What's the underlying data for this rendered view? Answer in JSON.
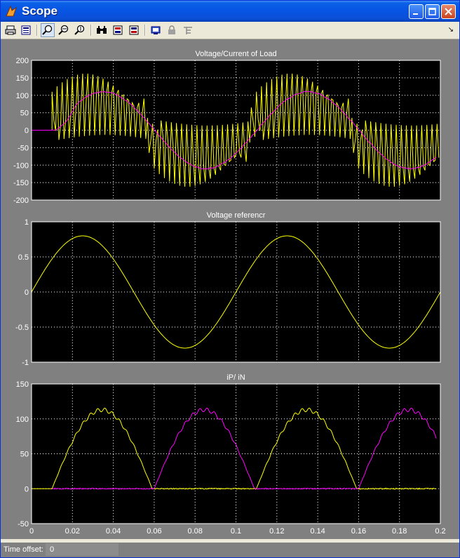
{
  "window": {
    "title": "Scope"
  },
  "toolbar": {
    "icons": [
      "print-icon",
      "parameters-icon",
      "zoom-icon",
      "zoom-x-icon",
      "zoom-y-icon",
      "autoscale-icon",
      "save-axes-icon",
      "restore-axes-icon",
      "floating-scope-icon",
      "lock-icon",
      "signal-selection-icon"
    ]
  },
  "status": {
    "label": "Time offset:",
    "value": "0"
  },
  "colors": {
    "background": "#000000",
    "axes_bg": "#808080",
    "series_yellow": "#ffff00",
    "series_magenta": "#ff00ff",
    "grid": "#ffffff"
  },
  "chart_data": [
    {
      "type": "line",
      "title": "Voltage/Current of Load",
      "xlim": [
        0,
        0.2
      ],
      "ylim": [
        -200,
        200
      ],
      "yticks": [
        -200,
        -150,
        -100,
        -50,
        0,
        50,
        100,
        150,
        200
      ],
      "xticks": [
        0,
        0.02,
        0.04,
        0.06,
        0.08,
        0.1,
        0.12,
        0.14,
        0.16,
        0.18,
        0.2
      ],
      "show_xtick_labels": false,
      "grid": true,
      "series": [
        {
          "color": "#ffff00",
          "kind": "pwm",
          "description_values": {
            "amplitude": 170,
            "freq_hz": 10,
            "start": 0.01,
            "pulses_per_period": 40
          },
          "values": []
        },
        {
          "color": "#ff00ff",
          "kind": "sine_ramp",
          "description_values": {
            "amplitude": 110,
            "freq_hz": 10,
            "start": 0.01,
            "phase_lag": 0.005
          },
          "values": []
        }
      ]
    },
    {
      "type": "line",
      "title": "Voltage referencr",
      "xlim": [
        0,
        0.2
      ],
      "ylim": [
        -1,
        1
      ],
      "yticks": [
        -1,
        -0.5,
        0,
        0.5,
        1
      ],
      "xticks": [
        0,
        0.02,
        0.04,
        0.06,
        0.08,
        0.1,
        0.12,
        0.14,
        0.16,
        0.18,
        0.2
      ],
      "show_xtick_labels": false,
      "grid": true,
      "series": [
        {
          "color": "#ffff00",
          "kind": "sine",
          "description_values": {
            "amplitude": 0.8,
            "freq_hz": 10,
            "start": 0
          },
          "values": []
        }
      ]
    },
    {
      "type": "line",
      "title": "iP/ iN",
      "xlim": [
        0,
        0.2
      ],
      "ylim": [
        -50,
        150
      ],
      "yticks": [
        -50,
        0,
        50,
        100,
        150
      ],
      "xticks": [
        0,
        0.02,
        0.04,
        0.06,
        0.08,
        0.1,
        0.12,
        0.14,
        0.16,
        0.18,
        0.2
      ],
      "xticklabels": [
        "0",
        "0.02",
        "0.04",
        "0.06",
        "0.08",
        "0.1",
        "0.12",
        "0.14",
        "0.16",
        "0.18",
        "0.2"
      ],
      "show_xtick_labels": true,
      "grid": true,
      "series": [
        {
          "color": "#ffff00",
          "kind": "half_rect",
          "description_values": {
            "amplitude": 113,
            "freq_hz": 10,
            "start": 0.01,
            "phase": 0.005,
            "positive": true
          },
          "values": []
        },
        {
          "color": "#ff00ff",
          "kind": "half_rect",
          "description_values": {
            "amplitude": 113,
            "freq_hz": 10,
            "start": 0.01,
            "phase": 0.005,
            "positive": false
          },
          "values": []
        }
      ]
    }
  ]
}
